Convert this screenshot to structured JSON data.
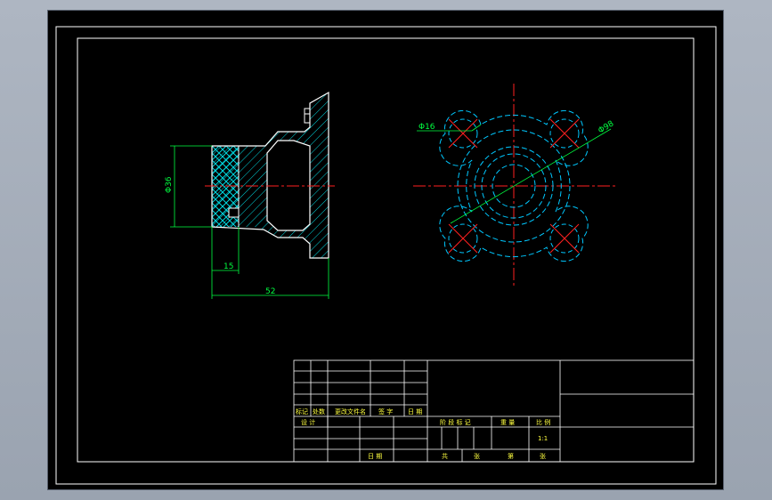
{
  "colors": {
    "background": "#000000",
    "frame": "#ffffff",
    "outline": "#ffffff",
    "hatch": "#00d8e0",
    "dimension": "#00ff40",
    "centerline": "#ff2020",
    "hidden": "#00c8ff",
    "title_text": "#ffff40"
  },
  "dimensions": {
    "side_diameter": "Φ36",
    "side_length_small": "15",
    "side_length_total": "52",
    "front_hole": "Φ16",
    "front_pitch": "Φ98"
  },
  "title_block": {
    "revision_headers": [
      "标记",
      "处数",
      "更改文件名",
      "签 字",
      "日 期"
    ],
    "design": "设 计",
    "date": "日 期",
    "stage_mark": "阶 段 标 记",
    "weight": "重 量",
    "scale_label": "比 例",
    "scale_value": "1:1",
    "total": "共",
    "sheet": "张",
    "number": "第",
    "sheet2": "张"
  }
}
